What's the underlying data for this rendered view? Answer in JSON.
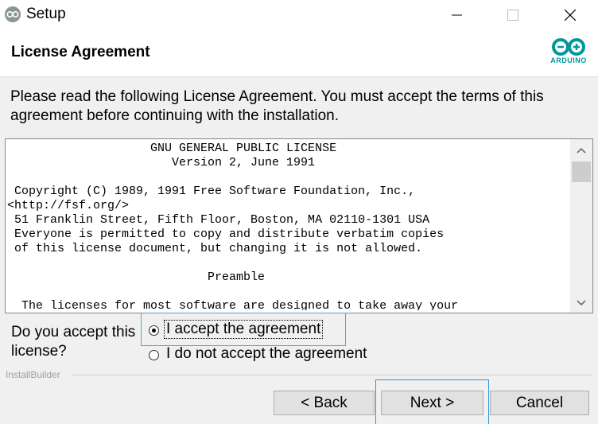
{
  "window": {
    "title": "Setup",
    "icon": "arduino-app-icon",
    "controls": [
      "minimize-icon",
      "maximize-icon",
      "close-icon"
    ]
  },
  "header": {
    "title": "License Agreement",
    "logo_text": "ARDUINO",
    "logo_color": "#00979c"
  },
  "instruction": "Please read the following License Agreement. You must accept the terms of this agreement before continuing with the installation.",
  "license": {
    "lines": [
      "                    GNU GENERAL PUBLIC LICENSE",
      "                       Version 2, June 1991",
      "",
      " Copyright (C) 1989, 1991 Free Software Foundation, Inc.,",
      "<http://fsf.org/>",
      " 51 Franklin Street, Fifth Floor, Boston, MA 02110-1301 USA",
      " Everyone is permitted to copy and distribute verbatim copies",
      " of this license document, but changing it is not allowed.",
      "",
      "                            Preamble",
      "",
      "  The licenses for most software are designed to take away your"
    ]
  },
  "accept": {
    "question": "Do you accept this license?",
    "option_accept": "I accept the agreement",
    "option_decline": "I do not accept the agreement",
    "selected": "accept"
  },
  "footer": {
    "brand": "InstallBuilder",
    "back_label": "< Back",
    "next_label": "Next >",
    "cancel_label": "Cancel"
  }
}
